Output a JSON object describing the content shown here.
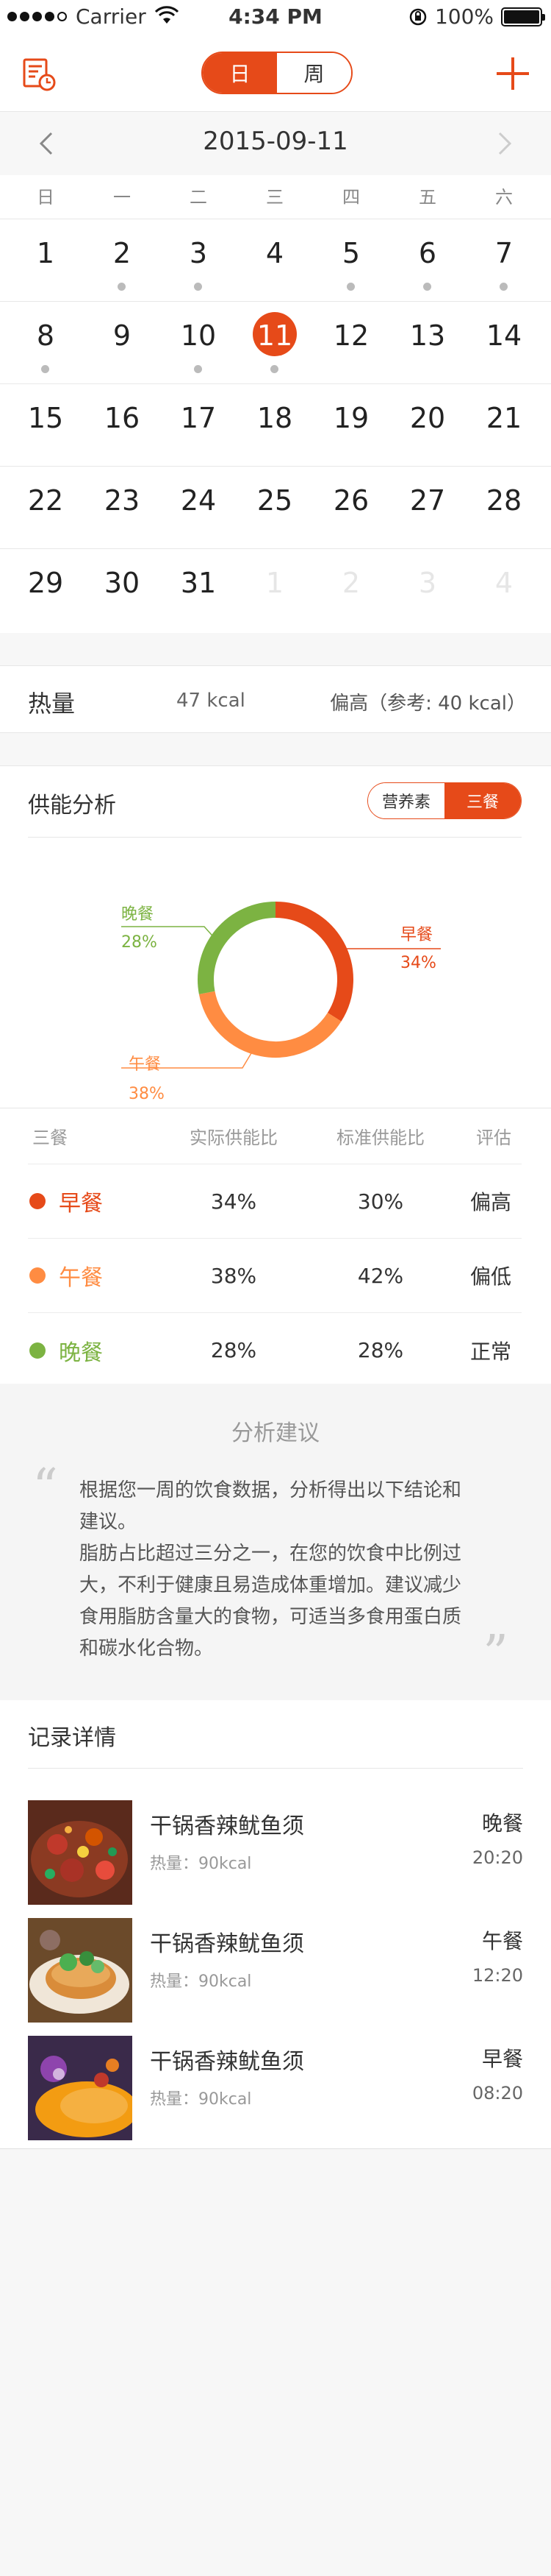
{
  "status_bar": {
    "carrier": "Carrier",
    "time": "4:34 PM",
    "battery": "100%"
  },
  "nav": {
    "seg_day": "日",
    "seg_week": "周"
  },
  "date": "2015-09-11",
  "weekdays": [
    "日",
    "一",
    "二",
    "三",
    "四",
    "五",
    "六"
  ],
  "calendar": [
    [
      {
        "d": "1",
        "dot": false
      },
      {
        "d": "2",
        "dot": true
      },
      {
        "d": "3",
        "dot": true
      },
      {
        "d": "4",
        "dot": false
      },
      {
        "d": "5",
        "dot": true
      },
      {
        "d": "6",
        "dot": true
      },
      {
        "d": "7",
        "dot": true
      }
    ],
    [
      {
        "d": "8",
        "dot": true
      },
      {
        "d": "9",
        "dot": false
      },
      {
        "d": "10",
        "dot": true
      },
      {
        "d": "11",
        "dot": true,
        "selected": true
      },
      {
        "d": "12",
        "dot": false
      },
      {
        "d": "13",
        "dot": false
      },
      {
        "d": "14",
        "dot": false
      }
    ],
    [
      {
        "d": "15"
      },
      {
        "d": "16"
      },
      {
        "d": "17"
      },
      {
        "d": "18"
      },
      {
        "d": "19"
      },
      {
        "d": "20"
      },
      {
        "d": "21"
      }
    ],
    [
      {
        "d": "22"
      },
      {
        "d": "23"
      },
      {
        "d": "24"
      },
      {
        "d": "25"
      },
      {
        "d": "26"
      },
      {
        "d": "27"
      },
      {
        "d": "28"
      }
    ],
    [
      {
        "d": "29"
      },
      {
        "d": "30"
      },
      {
        "d": "31"
      },
      {
        "d": "1",
        "dim": true
      },
      {
        "d": "2",
        "dim": true
      },
      {
        "d": "3",
        "dim": true
      },
      {
        "d": "4",
        "dim": true
      }
    ]
  ],
  "heat": {
    "label": "热量",
    "value": "47 kcal",
    "evaluation": "偏高（参考: 40 kcal）"
  },
  "analysis": {
    "title": "供能分析",
    "toggle_nutrient": "营养素",
    "toggle_meals": "三餐",
    "donut": [
      {
        "name": "早餐",
        "pct": "34%",
        "value": 34,
        "color": "#e64a19"
      },
      {
        "name": "午餐",
        "pct": "38%",
        "value": 38,
        "color": "#ff8c42"
      },
      {
        "name": "晚餐",
        "pct": "28%",
        "value": 28,
        "color": "#7cb342"
      }
    ],
    "table_headers": [
      "三餐",
      "实际供能比",
      "标准供能比",
      "评估"
    ],
    "rows": [
      {
        "meal": "早餐",
        "actual": "34%",
        "standard": "30%",
        "eval": "偏高",
        "color": "#e64a19"
      },
      {
        "meal": "午餐",
        "actual": "38%",
        "standard": "42%",
        "eval": "偏低",
        "color": "#ff8c42"
      },
      {
        "meal": "晚餐",
        "actual": "28%",
        "standard": "28%",
        "eval": "正常",
        "color": "#7cb342"
      }
    ]
  },
  "advice": {
    "title": "分析建议",
    "text": "根据您一周的饮食数据，分析得出以下结论和建议。\n脂肪占比超过三分之一，在您的饮食中比例过大，不利于健康且易造成体重增加。建议减少食用脂肪含量大的食物，可适当多食用蛋白质和碳水化合物。"
  },
  "records": {
    "title": "记录详情",
    "items": [
      {
        "name": "干锅香辣鱿鱼须",
        "calories": "热量：90kcal",
        "meal": "晚餐",
        "time": "20:20"
      },
      {
        "name": "干锅香辣鱿鱼须",
        "calories": "热量：90kcal",
        "meal": "午餐",
        "time": "12:20"
      },
      {
        "name": "干锅香辣鱿鱼须",
        "calories": "热量：90kcal",
        "meal": "早餐",
        "time": "08:20"
      }
    ]
  }
}
